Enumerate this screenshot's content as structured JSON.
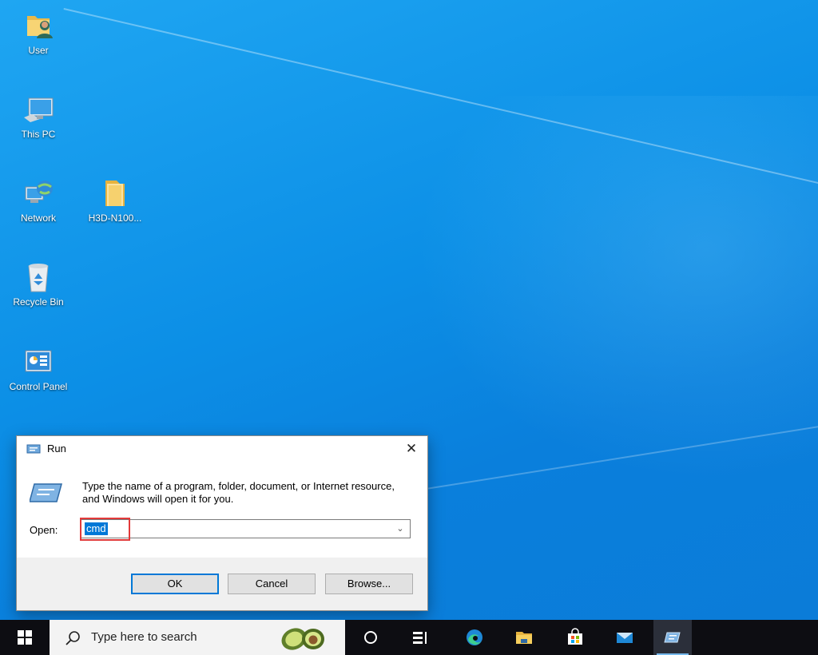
{
  "desktop": {
    "icons": [
      {
        "label": "User",
        "icon": "user-folder-icon"
      },
      {
        "label": "This PC",
        "icon": "computer-icon"
      },
      {
        "label": "Network",
        "icon": "network-icon"
      },
      {
        "label": "H3D-N100...",
        "icon": "folder-icon"
      },
      {
        "label": "Recycle Bin",
        "icon": "recycle-bin-icon"
      },
      {
        "label": "Control Panel",
        "icon": "control-panel-icon"
      }
    ]
  },
  "run_dialog": {
    "title": "Run",
    "description": "Type the name of a program, folder, document, or Internet resource, and Windows will open it for you.",
    "open_label": "Open:",
    "open_value": "cmd",
    "ok_label": "OK",
    "cancel_label": "Cancel",
    "browse_label": "Browse...",
    "close_glyph": "✕"
  },
  "taskbar": {
    "search_placeholder": "Type here to search",
    "apps": [
      {
        "name": "cortana-icon"
      },
      {
        "name": "task-view-icon"
      },
      {
        "name": "edge-icon"
      },
      {
        "name": "file-explorer-icon"
      },
      {
        "name": "microsoft-store-icon"
      },
      {
        "name": "mail-icon"
      },
      {
        "name": "run-icon",
        "active": true
      }
    ]
  },
  "colors": {
    "desktop_blue": "#0c8fe6",
    "accent": "#0078d7",
    "highlight_box": "#e23a3a",
    "taskbar": "#0d0d12"
  }
}
